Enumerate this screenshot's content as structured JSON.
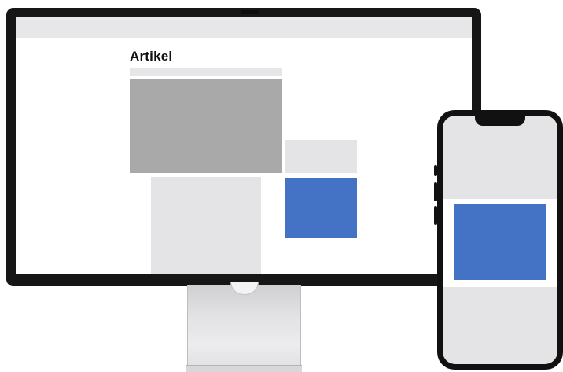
{
  "article": {
    "title": "Artikel"
  },
  "colors": {
    "accent_blue": "#4472c4",
    "placeholder_dark": "#a9a9a9",
    "placeholder_light": "#e4e4e6",
    "device_frame": "#161616"
  },
  "devices": [
    "desktop-monitor",
    "smartphone"
  ]
}
